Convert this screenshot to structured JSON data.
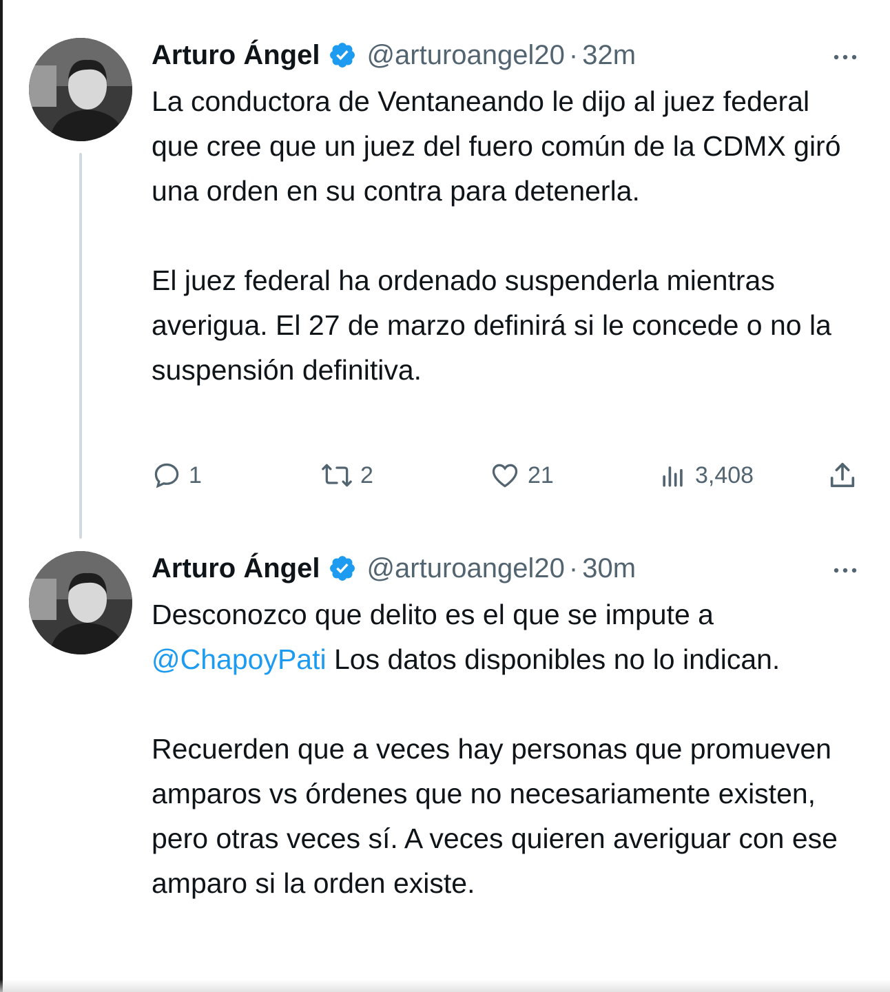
{
  "tweets": [
    {
      "author": "Arturo Ángel",
      "handle": "@arturoangel20",
      "separator": "·",
      "time": "32m",
      "paragraphs": [
        "La conductora de Ventaneando le dijo al juez federal que cree que un juez del fuero común de la CDMX giró una orden en su contra para detenerla.",
        "El juez federal ha ordenado suspenderla mientras averigua. El 27 de marzo definirá si le concede o no la suspensión definitiva."
      ],
      "replies": "1",
      "retweets": "2",
      "likes": "21",
      "views": "3,408"
    },
    {
      "author": "Arturo Ángel",
      "handle": "@arturoangel20",
      "separator": "·",
      "time": "30m",
      "para1_prefix": "Desconozco que delito es el que se impute a ",
      "mention": "@ChapoyPati",
      "para1_suffix": " Los datos disponibles no lo indican.",
      "para2": "Recuerden que a veces hay personas que promueven amparos vs órdenes que no necesariamente existen, pero otras veces sí. A veces quieren averiguar con ese amparo si la orden existe."
    }
  ],
  "colors": {
    "text": "#0f1419",
    "secondary": "#536471",
    "verified": "#1d9bf0",
    "mention": "#1d9bf0",
    "thread_line": "#cfd9de"
  },
  "icons": [
    "verified-badge-icon",
    "more-options-icon",
    "reply-icon",
    "retweet-icon",
    "like-icon",
    "views-icon",
    "share-icon"
  ]
}
